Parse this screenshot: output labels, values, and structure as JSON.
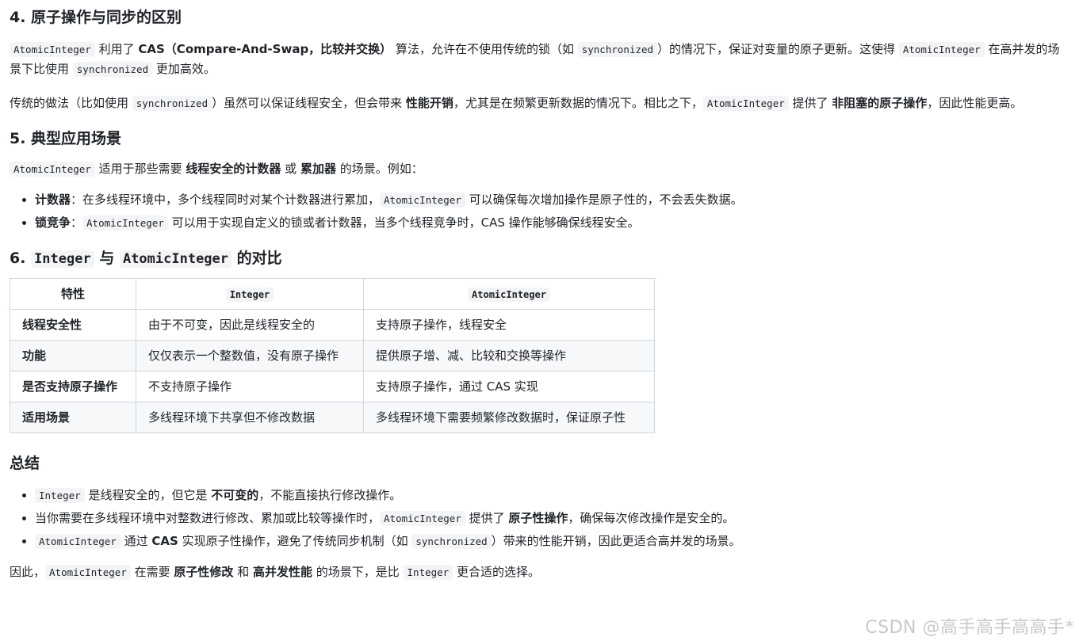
{
  "s4": {
    "title": "4. 原子操作与同步的区别",
    "p1": {
      "c1": "AtomicInteger",
      "t1": " 利用了 ",
      "b1": "CAS（Compare-And-Swap，比较并交换）",
      "t2": " 算法，允许在不使用传统的锁（如 ",
      "c2": "synchronized",
      "t3": "）的情况下，保证对变量的原子更新。这使得 ",
      "c3": "AtomicInteger",
      "t4": " 在高并发的场景下比使用 ",
      "c4": "synchronized",
      "t5": " 更加高效。"
    },
    "p2": {
      "t1": "传统的做法（比如使用 ",
      "c1": "synchronized",
      "t2": "）虽然可以保证线程安全，但会带来 ",
      "b1": "性能开销",
      "t3": "，尤其是在频繁更新数据的情况下。相比之下，",
      "c2": "AtomicInteger",
      "t4": " 提供了 ",
      "b2": "非阻塞的原子操作",
      "t5": "，因此性能更高。"
    }
  },
  "s5": {
    "title": "5. 典型应用场景",
    "p1": {
      "c1": "AtomicInteger",
      "t1": " 适用于那些需要 ",
      "b1": "线程安全的计数器",
      "t2": " 或 ",
      "b2": "累加器",
      "t3": " 的场景。例如："
    },
    "items": [
      {
        "b": "计数器",
        "t1": "：在多线程环境中，多个线程同时对某个计数器进行累加，",
        "c": "AtomicInteger",
        "t2": " 可以确保每次增加操作是原子性的，不会丢失数据。"
      },
      {
        "b": "锁竞争",
        "t1": "：",
        "c": "AtomicInteger",
        "t2": " 可以用于实现自定义的锁或者计数器，当多个线程竞争时，CAS 操作能够确保线程安全。"
      }
    ]
  },
  "s6": {
    "prefix": "6. ",
    "c1": "Integer",
    "mid": " 与 ",
    "c2": "AtomicInteger",
    "suffix": " 的对比",
    "table": {
      "headers": [
        "特性",
        "Integer",
        "AtomicInteger"
      ],
      "rows": [
        [
          "线程安全性",
          "由于不可变，因此是线程安全的",
          "支持原子操作，线程安全"
        ],
        [
          "功能",
          "仅仅表示一个整数值，没有原子操作",
          "提供原子增、减、比较和交换等操作"
        ],
        [
          "是否支持原子操作",
          "不支持原子操作",
          "支持原子操作，通过 CAS 实现"
        ],
        [
          "适用场景",
          "多线程环境下共享但不修改数据",
          "多线程环境下需要频繁修改数据时，保证原子性"
        ]
      ]
    }
  },
  "summary": {
    "title": "总结",
    "items": [
      {
        "c1": "Integer",
        "t1": " 是线程安全的，但它是 ",
        "b1": "不可变的",
        "t2": "，不能直接执行修改操作。"
      },
      {
        "t0": "当你需要在多线程环境中对整数进行修改、累加或比较等操作时，",
        "c1": "AtomicInteger",
        "t1": " 提供了 ",
        "b1": "原子性操作",
        "t2": "，确保每次修改操作是安全的。"
      },
      {
        "c1": "AtomicInteger",
        "t1": " 通过 ",
        "b1": "CAS",
        "t2": " 实现原子性操作，避免了传统同步机制（如 ",
        "c2": "synchronized",
        "t3": "）带来的性能开销，因此更适合高并发的场景。"
      }
    ],
    "final": {
      "t1": "因此，",
      "c1": "AtomicInteger",
      "t2": " 在需要 ",
      "b1": "原子性修改",
      "t3": " 和 ",
      "b2": "高并发性能",
      "t4": " 的场景下，是比 ",
      "c2": "Integer",
      "t5": " 更合适的选择。"
    }
  },
  "watermark": "CSDN @高手高手高高手*"
}
